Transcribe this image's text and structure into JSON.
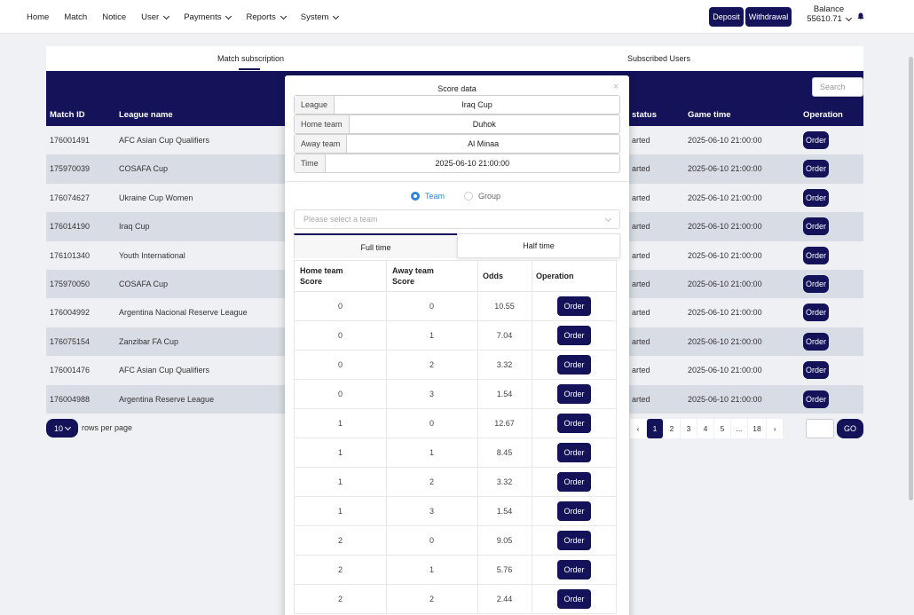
{
  "nav": {
    "items": [
      {
        "label": "Home",
        "dropdown": false
      },
      {
        "label": "Match",
        "dropdown": false
      },
      {
        "label": "Notice",
        "dropdown": false
      },
      {
        "label": "User",
        "dropdown": true
      },
      {
        "label": "Payments",
        "dropdown": true
      },
      {
        "label": "Reports",
        "dropdown": true
      },
      {
        "label": "System",
        "dropdown": true
      }
    ],
    "deposit_label": "Deposit",
    "withdrawal_label": "Withdrawal",
    "balance_label": "Balance",
    "balance_value": "55610.71"
  },
  "tabs": {
    "match_subscription": "Match subscription",
    "subscribed_users": "Subscribed Users"
  },
  "table": {
    "search_placeholder": "Search",
    "headers": {
      "match_id": "Match ID",
      "league_name": "League name",
      "status": "status",
      "game_time": "Game time",
      "operation": "Operation"
    },
    "rows": [
      {
        "id": "176001491",
        "league": "AFC Asian Cup Qualifiers",
        "status": "arted",
        "time": "2025-06-10 21:00:00",
        "action": "Order"
      },
      {
        "id": "175970039",
        "league": "COSAFA Cup",
        "status": "arted",
        "time": "2025-06-10 21:00:00",
        "action": "Order"
      },
      {
        "id": "176074627",
        "league": "Ukraine Cup Women",
        "status": "arted",
        "time": "2025-06-10 21:00:00",
        "action": "Order"
      },
      {
        "id": "176014190",
        "league": "Iraq Cup",
        "status": "arted",
        "time": "2025-06-10 21:00:00",
        "action": "Order"
      },
      {
        "id": "176101340",
        "league": "Youth International",
        "status": "arted",
        "time": "2025-06-10 21:00:00",
        "action": "Order"
      },
      {
        "id": "175970050",
        "league": "COSAFA Cup",
        "status": "arted",
        "time": "2025-06-10 21:00:00",
        "action": "Order"
      },
      {
        "id": "176004992",
        "league": "Argentina Nacional Reserve League",
        "status": "arted",
        "time": "2025-06-10 21:00:00",
        "action": "Order"
      },
      {
        "id": "176075154",
        "league": "Zanzibar FA Cup",
        "status": "arted",
        "time": "2025-06-10 21:00:00",
        "action": "Order"
      },
      {
        "id": "176001476",
        "league": "AFC Asian Cup Qualifiers",
        "status": "arted",
        "time": "2025-06-10 21:00:00",
        "action": "Order"
      },
      {
        "id": "176004988",
        "league": "Argentina Reserve League",
        "status": "arted",
        "time": "2025-06-10 21:00:00",
        "action": "Order"
      }
    ]
  },
  "pagination": {
    "rows_per_page_value": "10",
    "rows_per_page_label": "rows per page",
    "prev": "‹",
    "pages": [
      "1",
      "2",
      "3",
      "4",
      "5",
      "...",
      "18"
    ],
    "active_page": "1",
    "next": "›",
    "go_label": "GO"
  },
  "modal": {
    "title": "Score data",
    "close": "×",
    "league_label": "League",
    "league_value": "Iraq Cup",
    "home_label": "Home team",
    "home_value": "Duhok",
    "away_label": "Away team",
    "away_value": "Al Minaa",
    "time_label": "Time",
    "time_value": "2025-06-10 21:00:00",
    "radio_team": "Team",
    "radio_group": "Group",
    "selected_radio": "Team",
    "select_placeholder": "Please select a team",
    "tab_full": "Full time",
    "tab_half": "Half time",
    "score_headers": {
      "home_line1": "Home team",
      "home_line2": "Score",
      "away_line1": "Away team",
      "away_line2": "Score",
      "odds": "Odds",
      "operation": "Operation"
    },
    "scores": [
      {
        "home": "0",
        "away": "0",
        "odds": "10.55",
        "action": "Order"
      },
      {
        "home": "0",
        "away": "1",
        "odds": "7.04",
        "action": "Order"
      },
      {
        "home": "0",
        "away": "2",
        "odds": "3.32",
        "action": "Order"
      },
      {
        "home": "0",
        "away": "3",
        "odds": "1.54",
        "action": "Order"
      },
      {
        "home": "1",
        "away": "0",
        "odds": "12.67",
        "action": "Order"
      },
      {
        "home": "1",
        "away": "1",
        "odds": "8.45",
        "action": "Order"
      },
      {
        "home": "1",
        "away": "2",
        "odds": "3.32",
        "action": "Order"
      },
      {
        "home": "1",
        "away": "3",
        "odds": "1.54",
        "action": "Order"
      },
      {
        "home": "2",
        "away": "0",
        "odds": "9.05",
        "action": "Order"
      },
      {
        "home": "2",
        "away": "1",
        "odds": "5.76",
        "action": "Order"
      },
      {
        "home": "2",
        "away": "2",
        "odds": "2.44",
        "action": "Order"
      }
    ]
  },
  "colors": {
    "primary": "#14135a",
    "row_odd": "#eff0f4",
    "row_even": "#d8dde5",
    "radio_active": "#2f86d8"
  },
  "icons": [
    "chevron-down-icon",
    "bell-icon",
    "close-icon",
    "radio-icon"
  ]
}
